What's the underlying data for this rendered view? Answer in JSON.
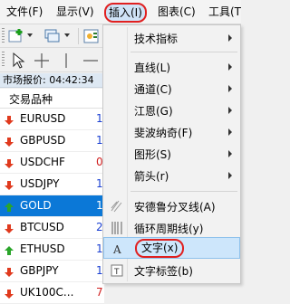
{
  "menubar": {
    "items": [
      {
        "label": "文件(F)"
      },
      {
        "label": "显示(V)"
      },
      {
        "label": "插入(I)"
      },
      {
        "label": "图表(C)"
      },
      {
        "label": "工具(T"
      }
    ]
  },
  "market_watch": {
    "header": "市场报价: 04:42:34",
    "column_label": "交易品种",
    "rows": [
      {
        "symbol": "EURUSD",
        "value": "1",
        "direction": "down"
      },
      {
        "symbol": "GBPUSD",
        "value": "1",
        "direction": "down"
      },
      {
        "symbol": "USDCHF",
        "value": "0",
        "direction": "down"
      },
      {
        "symbol": "USDJPY",
        "value": "1",
        "direction": "down"
      },
      {
        "symbol": "GOLD",
        "value": "1",
        "direction": "up"
      },
      {
        "symbol": "BTCUSD",
        "value": "2",
        "direction": "down"
      },
      {
        "symbol": "ETHUSD",
        "value": "1",
        "direction": "up"
      },
      {
        "symbol": "GBPJPY",
        "value": "1",
        "direction": "down"
      },
      {
        "symbol": "UK100C...",
        "value": "7",
        "direction": "down"
      }
    ]
  },
  "insert_menu": {
    "items": [
      {
        "label": "技术指标",
        "submenu": true
      },
      {
        "label": "直线(L)",
        "submenu": true
      },
      {
        "label": "通道(C)",
        "submenu": true
      },
      {
        "label": "江恩(G)",
        "submenu": true
      },
      {
        "label": "斐波纳奇(F)",
        "submenu": true
      },
      {
        "label": "图形(S)",
        "submenu": true
      },
      {
        "label": "箭头(r)",
        "submenu": true
      },
      {
        "label": "安德鲁分叉线(A)",
        "icon": "andrews-pitchfork-icon"
      },
      {
        "label": "循环周期线(y)",
        "icon": "cycle-lines-icon"
      },
      {
        "label": "文字(x)",
        "icon": "text-icon",
        "highlighted": true
      },
      {
        "label": "文字标签(b)",
        "icon": "text-label-icon"
      }
    ]
  },
  "colors": {
    "selected_row": "#0b78d7",
    "up_arrow": "#2aa52a",
    "down_arrow": "#e03a1e",
    "highlight_circle": "#e02020",
    "menu_hover": "#cde6fb"
  }
}
